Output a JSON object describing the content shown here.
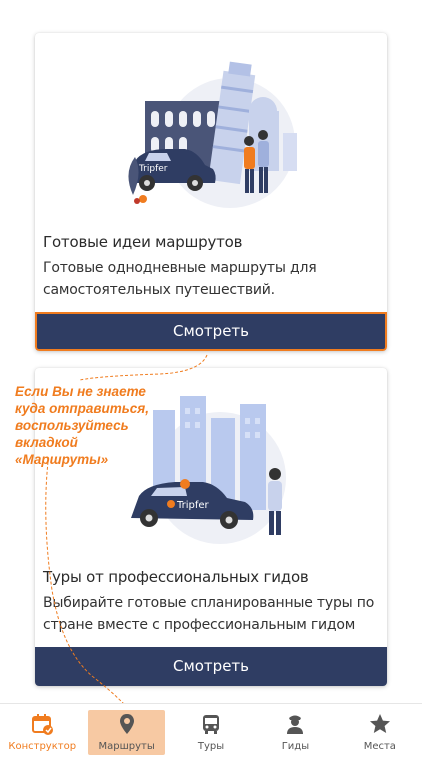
{
  "cards": [
    {
      "title": "Готовые идеи маршрутов",
      "description": "Готовые однодневные маршруты для самостоятельных путешествий.",
      "button_label": "Смотреть"
    },
    {
      "title": "Туры от профессиональных гидов",
      "description": "Выбирайте готовые спланированные туры по стране вместе с профессиональным гидом",
      "button_label": "Смотреть"
    }
  ],
  "illustration_brand": "Tripfer",
  "hint": {
    "lines": [
      "Если Вы не знаете",
      "куда отправиться,",
      "воспользуйтесь",
      "вкладкой",
      "«Маршруты»"
    ]
  },
  "tabbar": {
    "items": [
      {
        "label": "Конструктор",
        "icon": "calendar-icon"
      },
      {
        "label": "Маршруты",
        "icon": "map-pin-icon"
      },
      {
        "label": "Туры",
        "icon": "bus-icon"
      },
      {
        "label": "Гиды",
        "icon": "guide-icon"
      },
      {
        "label": "Места",
        "icon": "star-icon"
      }
    ]
  },
  "colors": {
    "accent": "#f07c1f",
    "button": "#2f3d63",
    "highlight": "#f7c9a3"
  }
}
